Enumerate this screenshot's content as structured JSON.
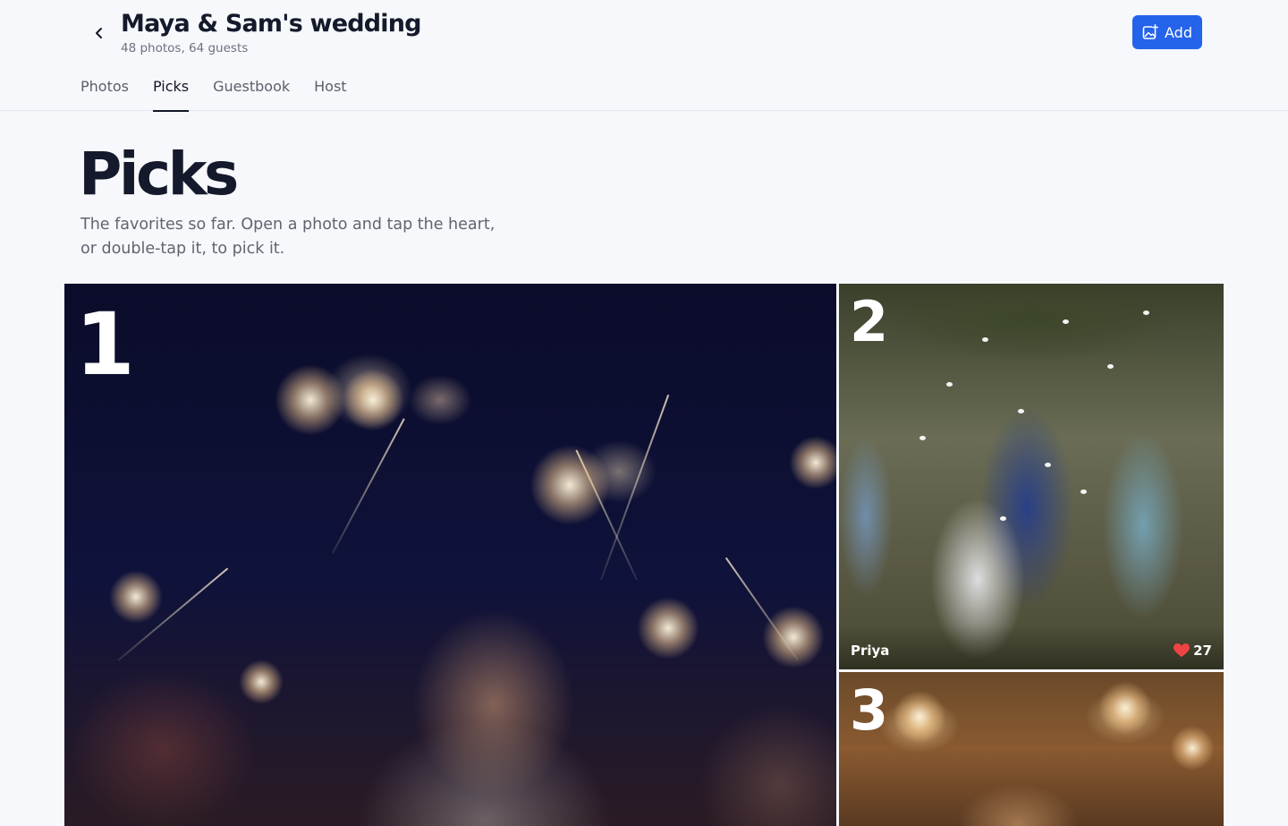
{
  "header": {
    "title": "Maya & Sam's wedding",
    "subtitle": "48 photos, 64 guests",
    "add_label": "Add"
  },
  "tabs": [
    {
      "label": "Photos",
      "active": false
    },
    {
      "label": "Picks",
      "active": true
    },
    {
      "label": "Guestbook",
      "active": false
    },
    {
      "label": "Host",
      "active": false
    }
  ],
  "page": {
    "heading": "Picks",
    "description": "The favorites so far. Open a photo and tap the heart, or double-tap it, to pick it."
  },
  "picks": [
    {
      "rank": "1",
      "author": "",
      "likes": ""
    },
    {
      "rank": "2",
      "author": "Priya",
      "likes": "27"
    },
    {
      "rank": "3",
      "author": "",
      "likes": ""
    }
  ],
  "colors": {
    "accent": "#2563eb",
    "background": "#f6f8fb",
    "heart": "#ef4444"
  },
  "icons": {
    "back": "chevron-left-icon",
    "add": "add-photo-icon",
    "like": "heart-icon"
  }
}
